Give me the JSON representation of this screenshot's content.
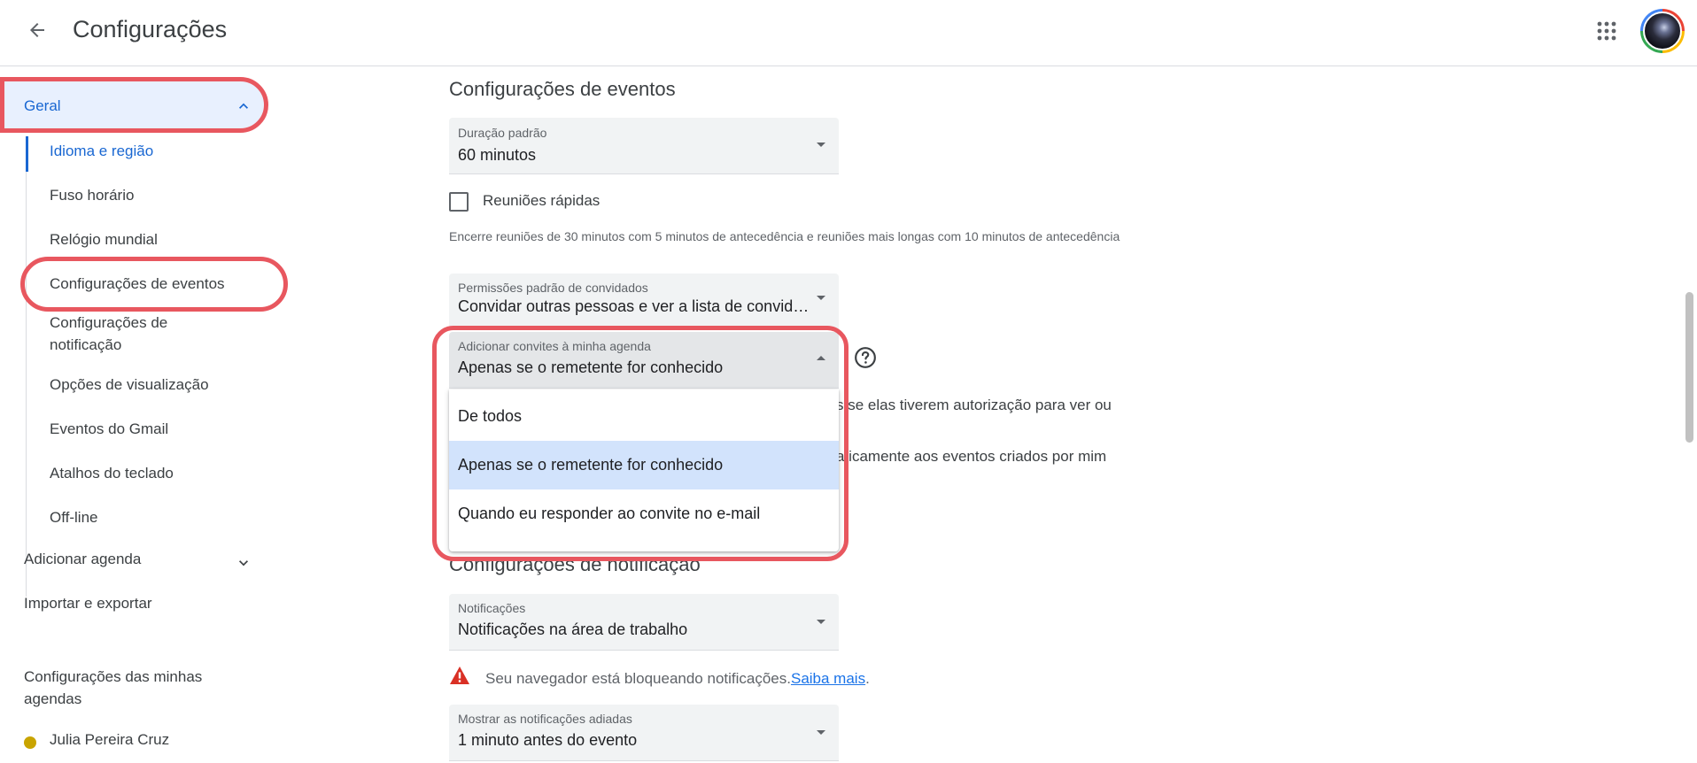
{
  "header": {
    "title": "Configurações",
    "back_icon": "arrow-left-icon",
    "apps_icon": "apps-grid-icon"
  },
  "sidebar": {
    "general_label": "Geral",
    "general_subitems": [
      "Idioma e região",
      "Fuso horário",
      "Relógio mundial",
      "Configurações de eventos",
      "Configurações de notificação",
      "Opções de visualização",
      "Eventos do Gmail",
      "Atalhos do teclado",
      "Off-line"
    ],
    "add_calendar": "Adicionar agenda",
    "import_export": "Importar e exportar",
    "my_calendars_heading": "Configurações das minhas agendas",
    "calendar_name": "Julia Pereira Cruz",
    "calendar_color": "#c9a400"
  },
  "main": {
    "event_settings_title": "Configurações de eventos",
    "default_duration": {
      "label": "Duração padrão",
      "value": "60 minutos"
    },
    "speedy_meetings": {
      "label": "Reuniões rápidas",
      "checked": false,
      "helper": "Encerre reuniões de 30 minutos com 5 minutos de antecedência e reuniões mais longas com 10 minutos de antecedência"
    },
    "guest_permissions": {
      "label": "Permissões padrão de convidados",
      "value": "Convidar outras pessoas e ver a lista de convidad..."
    },
    "add_invitations": {
      "label": "Adicionar convites à minha agenda",
      "value": "Apenas se o remetente for conhecido",
      "options": [
        "De todos",
        "Apenas se o remetente for conhecido",
        "Quando eu responder ao convite no e-mail"
      ],
      "selected_index": 1
    },
    "partial_text_1": "s se elas tiverem autorização para ver ou",
    "partial_text_2": "aticamente aos eventos criados por mim",
    "notification_settings_title": "Configurações de notificação",
    "notifications": {
      "label": "Notificações",
      "value": "Notificações na área de trabalho"
    },
    "warning": {
      "text": "Seu navegador está bloqueando notificações.",
      "link": "Saiba mais",
      "suffix": "."
    },
    "snoozed": {
      "label": "Mostrar as notificações adiadas",
      "value": "1 minuto antes do evento"
    }
  },
  "colors": {
    "accent": "#1967d2",
    "highlight_ring": "#e8575f",
    "selected_option": "#d2e3fc",
    "warning": "#d93025"
  }
}
